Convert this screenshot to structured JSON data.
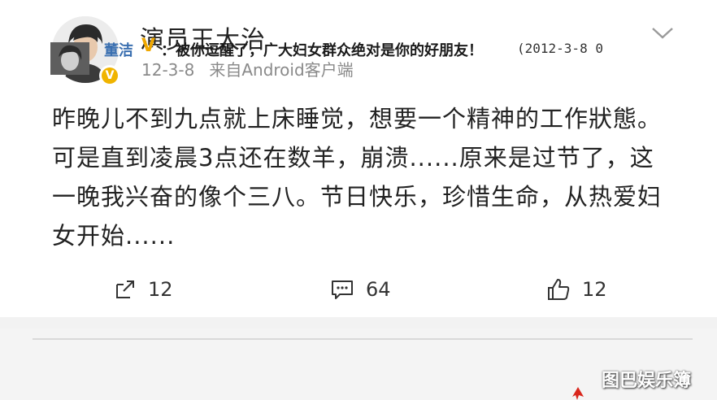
{
  "post": {
    "author": "演员王大治",
    "date": "12-3-8",
    "source": "来自Android客户端",
    "content": "昨晚儿不到九点就上床睡觉，想要一个精神的工作狀態。可是直到凌晨3点还在数羊，崩溃......原来是过节了，这一晚我兴奋的像个三八。节日快乐，珍惜生命，从热爱妇女开始......",
    "icons": {
      "avatar": "avatar",
      "verified": "verified-badge-icon",
      "menu": "chevron-down-icon"
    }
  },
  "actions": {
    "repost": {
      "icon": "repost-icon",
      "count": "12"
    },
    "comment": {
      "icon": "comment-icon",
      "count": "64"
    },
    "like": {
      "icon": "thumbs-up-icon",
      "count": "12"
    }
  },
  "comment": {
    "name": "董洁",
    "badge": "V",
    "text": "：被你逗醒了，广大妇女群众绝对是你的好朋友！",
    "date": "(2012-3-8  0",
    "watermark": "图巴娱乐簿"
  },
  "colors": {
    "verified": "#f0b400",
    "comment_name": "#3a6fb0",
    "arrow": "#d9261c"
  }
}
